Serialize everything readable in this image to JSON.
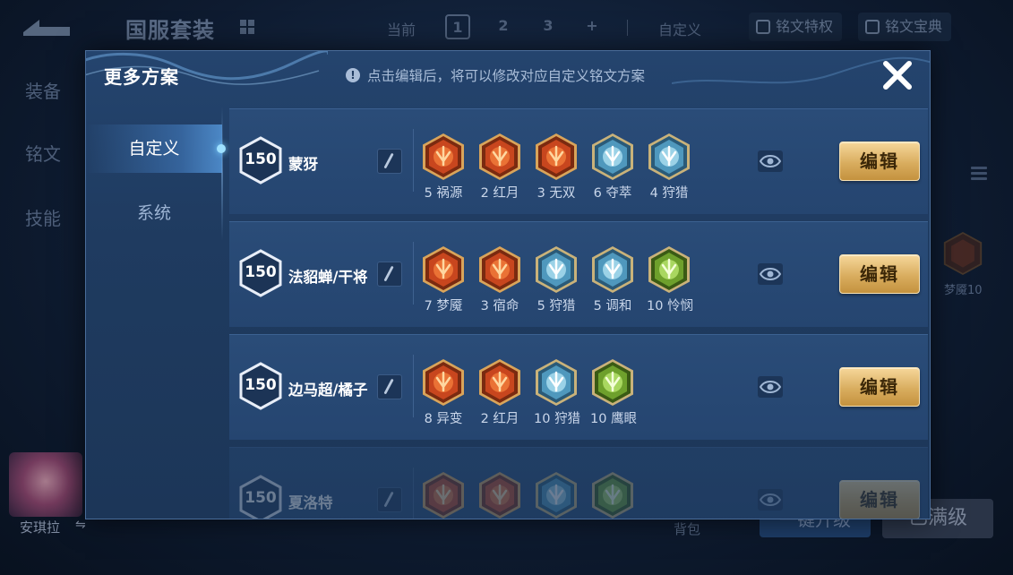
{
  "background": {
    "title": "国服套装",
    "current_label": "当前",
    "page_tabs": [
      "1",
      "2",
      "3",
      "+"
    ],
    "custom_label": "自定义",
    "privilege_btn": "铭文特权",
    "codex_btn": "铭文宝典",
    "side_items": [
      "装备",
      "铭文",
      "技能"
    ],
    "right_rune_label": "梦魇10",
    "hero_name": "安琪拉",
    "bottom_label": "背包",
    "upgrade_btn": "一键升级",
    "max_level_btn": "已满级"
  },
  "modal": {
    "title": "更多方案",
    "tip": "点击编辑后，将可以修改对应自定义铭文方案",
    "nav": [
      {
        "label": "自定义",
        "active": true
      },
      {
        "label": "系统",
        "active": false
      }
    ],
    "edit_label": "编辑",
    "plans": [
      {
        "level": "150",
        "name": "蒙犽",
        "runes": [
          {
            "count": "5",
            "name": "祸源",
            "color": "red",
            "icon": "huoyuan-rune-icon"
          },
          {
            "count": "2",
            "name": "红月",
            "color": "red",
            "icon": "hongyue-rune-icon"
          },
          {
            "count": "3",
            "name": "无双",
            "color": "red",
            "icon": "wushuang-rune-icon"
          },
          {
            "count": "6",
            "name": "夺萃",
            "color": "blue",
            "icon": "duocui-rune-icon"
          },
          {
            "count": "4",
            "name": "狩猎",
            "color": "blue",
            "icon": "shoulie-rune-icon"
          }
        ]
      },
      {
        "level": "150",
        "name": "法貂蝉/干将",
        "runes": [
          {
            "count": "7",
            "name": "梦魇",
            "color": "red",
            "icon": "mengyan-rune-icon"
          },
          {
            "count": "3",
            "name": "宿命",
            "color": "red",
            "icon": "suming-rune-icon"
          },
          {
            "count": "5",
            "name": "狩猎",
            "color": "blue",
            "icon": "shoulie-rune-icon"
          },
          {
            "count": "5",
            "name": "调和",
            "color": "blue",
            "icon": "tiaohe-rune-icon"
          },
          {
            "count": "10",
            "name": "怜悯",
            "color": "green",
            "icon": "lianmin-rune-icon"
          }
        ]
      },
      {
        "level": "150",
        "name": "边马超/橘子",
        "runes": [
          {
            "count": "8",
            "name": "异变",
            "color": "red",
            "icon": "yibian-rune-icon"
          },
          {
            "count": "2",
            "name": "红月",
            "color": "red",
            "icon": "hongyue-rune-icon"
          },
          {
            "count": "10",
            "name": "狩猎",
            "color": "blue",
            "icon": "shoulie-rune-icon"
          },
          {
            "count": "10",
            "name": "鹰眼",
            "color": "green",
            "icon": "yingyan-rune-icon"
          }
        ]
      },
      {
        "level": "150",
        "name": "夏洛特",
        "runes": [
          {
            "count": "",
            "name": "",
            "color": "red",
            "icon": "red-rune-icon"
          },
          {
            "count": "",
            "name": "",
            "color": "red",
            "icon": "red-rune-icon"
          },
          {
            "count": "",
            "name": "",
            "color": "blue",
            "icon": "blue-rune-icon"
          },
          {
            "count": "",
            "name": "",
            "color": "green",
            "icon": "green-rune-icon"
          }
        ]
      }
    ]
  },
  "colors": {
    "rune_red": "#d0401e",
    "rune_blue": "#6fb6d6",
    "rune_green": "#7fbf3a",
    "edit_gold": "#d9ad5f"
  }
}
